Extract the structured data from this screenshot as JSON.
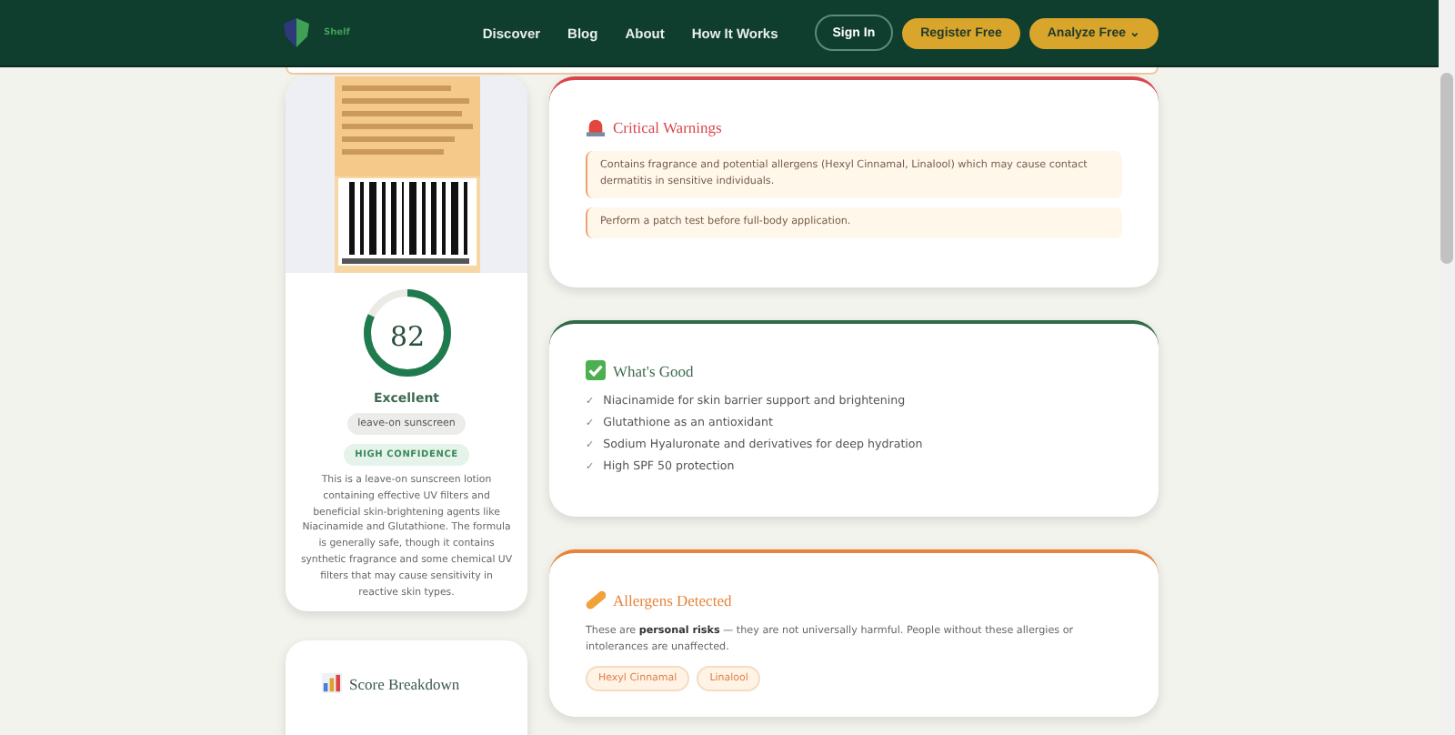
{
  "nav": {
    "brand": "Shelf",
    "links": [
      {
        "label": "Discover"
      },
      {
        "label": "Blog"
      },
      {
        "label": "About"
      },
      {
        "label": "How It Works"
      }
    ],
    "buttons": [
      {
        "label": "Sign In",
        "kind": "outline"
      },
      {
        "label": "Register Free",
        "kind": "solid"
      },
      {
        "label": "Analyze Free ⌄",
        "kind": "solid"
      }
    ]
  },
  "product": {
    "score": {
      "value": "82",
      "level": 0.82,
      "rating": "Excellent"
    },
    "category": "leave-on sunscreen",
    "confidence": "HIGH CONFIDENCE",
    "summary": "This is a leave-on sunscreen lotion containing effective UV filters and beneficial skin-brightening agents like Niacinamide and Glutathione. The formula is generally safe, though it contains synthetic fragrance and some chemical UV filters that may cause sensitivity in reactive skin types."
  },
  "score_breakdown": {
    "title": "Score Breakdown"
  },
  "sections": [
    {
      "kind": "warnings",
      "title": "Critical Warnings",
      "color": "#d9464a",
      "items": [
        "Contains fragrance and potential allergens (Hexyl Cinnamal, Linalool) which may cause contact dermatitis in sensitive individuals.",
        "Perform a patch test before full-body application."
      ]
    },
    {
      "kind": "good",
      "title": "What's Good",
      "color": "#2f6b47",
      "mark": "✓",
      "items": [
        "Niacinamide for skin barrier support and brightening",
        "Glutathione as an antioxidant",
        "Sodium Hyaluronate and derivatives for deep hydration",
        "High SPF 50 protection"
      ]
    },
    {
      "kind": "allergens",
      "title": "Allergens Detected",
      "color": "#e8833a",
      "note": "These are **personal risks** — they are not universally harmful. People without these allergies or intolerances are unaffected.",
      "items": [
        "Hexyl Cinnamal",
        "Linalool"
      ]
    }
  ]
}
